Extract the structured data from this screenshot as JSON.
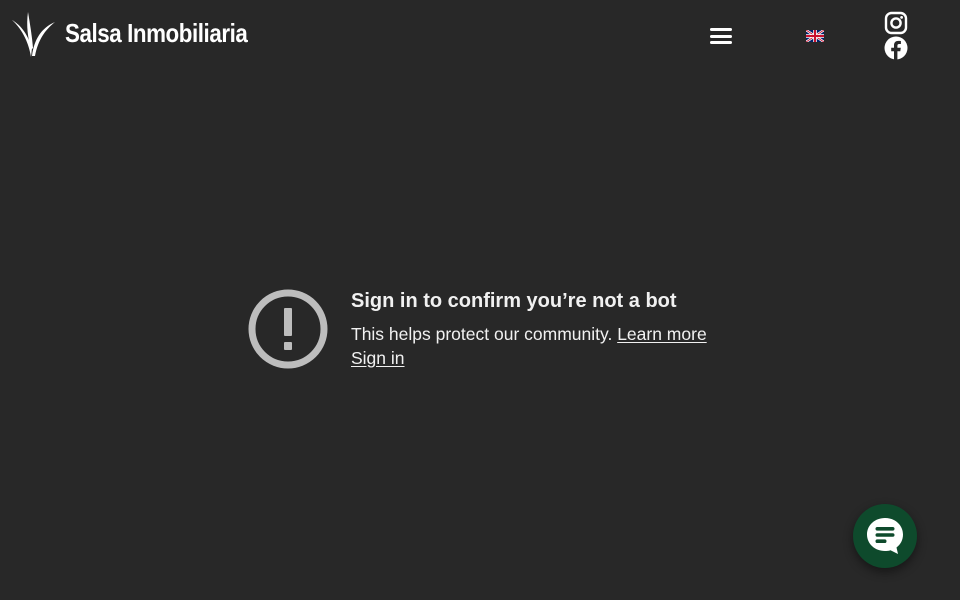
{
  "header": {
    "brand_name": "Salsa Inmobiliaria",
    "icons": {
      "logo": "palm-leaf-logo-icon",
      "menu": "hamburger-menu-icon",
      "language": "uk-flag-icon",
      "instagram": "instagram-icon",
      "facebook": "facebook-icon"
    }
  },
  "notice": {
    "icon": "exclamation-circle-icon",
    "title": "Sign in to confirm you’re not a bot",
    "message": "This helps protect our community.",
    "learn_more_label": "Learn more",
    "sign_in_label": "Sign in"
  },
  "chat": {
    "icon": "chat-bubble-icon"
  },
  "colors": {
    "background": "#282828",
    "text": "#f1f1f1",
    "alert_icon": "#bdbdbd",
    "chat_button": "#0e4a2c"
  }
}
